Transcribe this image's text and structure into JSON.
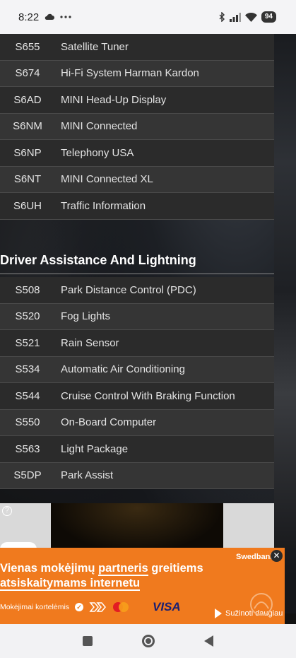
{
  "status_bar": {
    "time": "8:22",
    "battery": "94"
  },
  "media_table": {
    "rows": [
      {
        "code": "S655",
        "desc": "Satellite Tuner"
      },
      {
        "code": "S674",
        "desc": "Hi-Fi System Harman Kardon"
      },
      {
        "code": "S6AD",
        "desc": "MINI Head-Up Display"
      },
      {
        "code": "S6NM",
        "desc": "MINI Connected"
      },
      {
        "code": "S6NP",
        "desc": "Telephony USA"
      },
      {
        "code": "S6NT",
        "desc": "MINI Connected XL"
      },
      {
        "code": "S6UH",
        "desc": "Traffic Information"
      }
    ]
  },
  "section": {
    "title": "Driver Assistance And Lightning"
  },
  "assist_table": {
    "rows": [
      {
        "code": "S508",
        "desc": "Park Distance Control (PDC)"
      },
      {
        "code": "S520",
        "desc": "Fog Lights"
      },
      {
        "code": "S521",
        "desc": "Rain Sensor"
      },
      {
        "code": "S534",
        "desc": "Automatic Air Conditioning"
      },
      {
        "code": "S544",
        "desc": "Cruise Control With Braking Function"
      },
      {
        "code": "S550",
        "desc": "On-Board Computer"
      },
      {
        "code": "S563",
        "desc": "Light Package"
      },
      {
        "code": "S5DP",
        "desc": "Park Assist"
      }
    ]
  },
  "ad": {
    "info_icon": "?",
    "brand": "Swedbank",
    "close": "✕",
    "headline_part1": "Vienas mokėjimų ",
    "headline_underlined": "partneris",
    "headline_part2": " greitiems",
    "headline_line2": "atsiskaitymams internetu",
    "payments_label": "Mokėjimai kortelėmis",
    "visa": "VISA",
    "learn_more": "Sužinoti daugiau"
  }
}
